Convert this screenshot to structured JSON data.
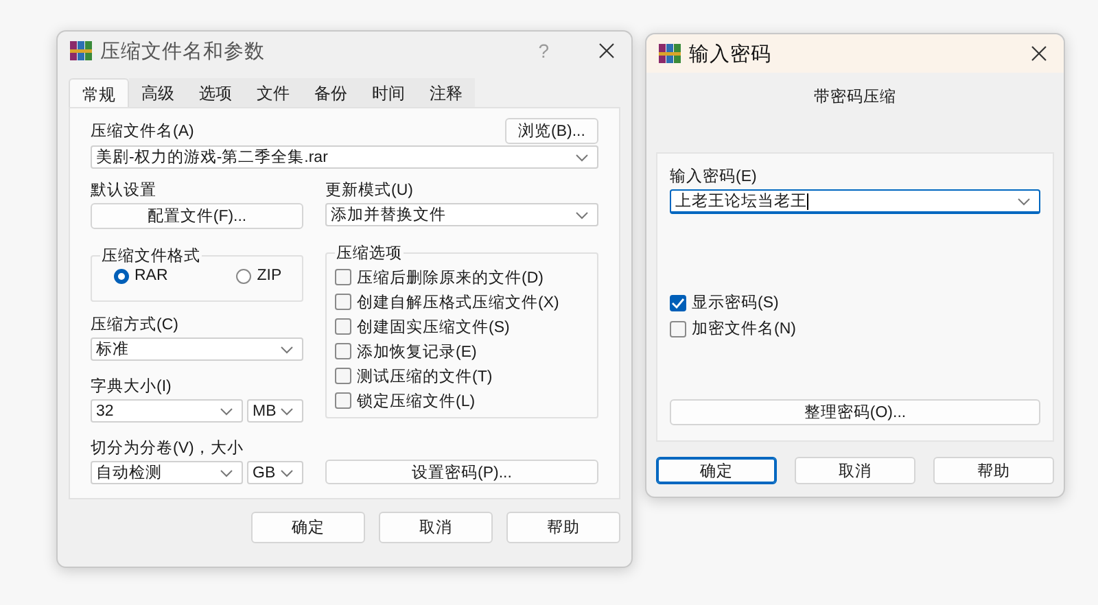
{
  "compress_dialog": {
    "title": "压缩文件名和参数",
    "help_glyph": "?",
    "tabs": [
      {
        "label": "常规",
        "selected": true
      },
      {
        "label": "高级",
        "selected": false
      },
      {
        "label": "选项",
        "selected": false
      },
      {
        "label": "文件",
        "selected": false
      },
      {
        "label": "备份",
        "selected": false
      },
      {
        "label": "时间",
        "selected": false
      },
      {
        "label": "注释",
        "selected": false
      }
    ],
    "archive_name": {
      "label": "压缩文件名(A)",
      "browse_button": "浏览(B)...",
      "value": "美剧-权力的游戏-第二季全集.rar"
    },
    "default_settings": {
      "label": "默认设置",
      "button": "配置文件(F)..."
    },
    "update_mode": {
      "label": "更新模式(U)",
      "value": "添加并替换文件"
    },
    "format_group": {
      "title": "压缩文件格式",
      "options": [
        {
          "label": "RAR",
          "selected": true
        },
        {
          "label": "ZIP",
          "selected": false
        }
      ]
    },
    "options_group": {
      "title": "压缩选项",
      "checkboxes": [
        {
          "label": "压缩后删除原来的文件(D)",
          "checked": false
        },
        {
          "label": "创建自解压格式压缩文件(X)",
          "checked": false
        },
        {
          "label": "创建固实压缩文件(S)",
          "checked": false
        },
        {
          "label": "添加恢复记录(E)",
          "checked": false
        },
        {
          "label": "测试压缩的文件(T)",
          "checked": false
        },
        {
          "label": "锁定压缩文件(L)",
          "checked": false
        }
      ]
    },
    "method": {
      "label": "压缩方式(C)",
      "value": "标准"
    },
    "dictionary": {
      "label": "字典大小(I)",
      "value": "32",
      "unit": "MB"
    },
    "split": {
      "label": "切分为分卷(V)，大小",
      "value": "自动检测",
      "unit": "GB"
    },
    "password_button": "设置密码(P)...",
    "buttons": [
      "确定",
      "取消",
      "帮助"
    ]
  },
  "password_dialog": {
    "title": "输入密码",
    "subtitle": "带密码压缩",
    "field": {
      "label": "输入密码(E)",
      "value": "上老王论坛当老王"
    },
    "checkboxes": [
      {
        "label": "显示密码(S)",
        "checked": true
      },
      {
        "label": "加密文件名(N)",
        "checked": false
      }
    ],
    "organize_button": "整理密码(O)...",
    "buttons": [
      {
        "label": "确定",
        "selected": true
      },
      {
        "label": "取消",
        "selected": false
      },
      {
        "label": "帮助",
        "selected": false
      }
    ]
  }
}
